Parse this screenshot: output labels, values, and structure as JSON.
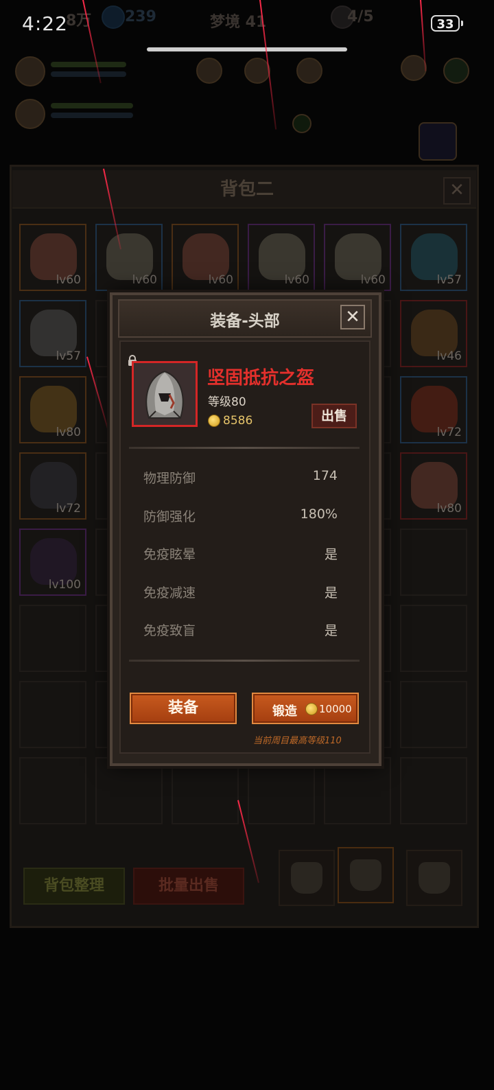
{
  "status_bar": {
    "time": "4:22",
    "battery": "33"
  },
  "hud": {
    "gold_partial": "8万",
    "gems": "239",
    "dream_level": "梦境 41",
    "skull_count": "4/5"
  },
  "bag": {
    "title": "背包二",
    "slots": [
      {
        "level": "lv60",
        "rarity": "orange",
        "art": "helmet"
      },
      {
        "level": "lv60",
        "rarity": "blue",
        "art": "shoulder"
      },
      {
        "level": "lv60",
        "rarity": "orange",
        "art": "helmet"
      },
      {
        "level": "lv60",
        "rarity": "purple",
        "art": "shoulder"
      },
      {
        "level": "lv60",
        "rarity": "purple",
        "art": "shoulder"
      },
      {
        "level": "lv57",
        "rarity": "blue",
        "art": "orb"
      },
      {
        "level": "lv57",
        "rarity": "blue",
        "art": "gauntlet"
      },
      {
        "level": "lv46",
        "rarity": "red",
        "art": "shield"
      },
      {
        "level": "lv80",
        "rarity": "orange",
        "art": "feather"
      },
      {
        "level": "lv72",
        "rarity": "blue",
        "art": "staff"
      },
      {
        "level": "lv72",
        "rarity": "orange",
        "art": "armor"
      },
      {
        "level": "lv80",
        "rarity": "red",
        "art": "helmet"
      },
      {
        "level": "lv100",
        "rarity": "purple",
        "art": "cloak"
      }
    ],
    "sort_label": "背包整理",
    "bulk_sell_label": "批量出售"
  },
  "modal": {
    "title": "装备-头部",
    "item_name": "坚固抵抗之盔",
    "item_level": "等级80",
    "price": "8586",
    "sell_label": "出售",
    "stats": [
      {
        "label": "物理防御",
        "value": "174"
      },
      {
        "label": "防御强化",
        "value": "180%"
      },
      {
        "label": "免疫眩晕",
        "value": "是"
      },
      {
        "label": "免疫减速",
        "value": "是"
      },
      {
        "label": "免疫致盲",
        "value": "是"
      }
    ],
    "equip_label": "装备",
    "forge_label": "锻造",
    "forge_cost": "10000",
    "footnote": "当前周目最高等级110"
  },
  "colors": {
    "item_name": "#e4302c",
    "rarity_red": "#d42626",
    "button_orange": "#c85a1e"
  }
}
